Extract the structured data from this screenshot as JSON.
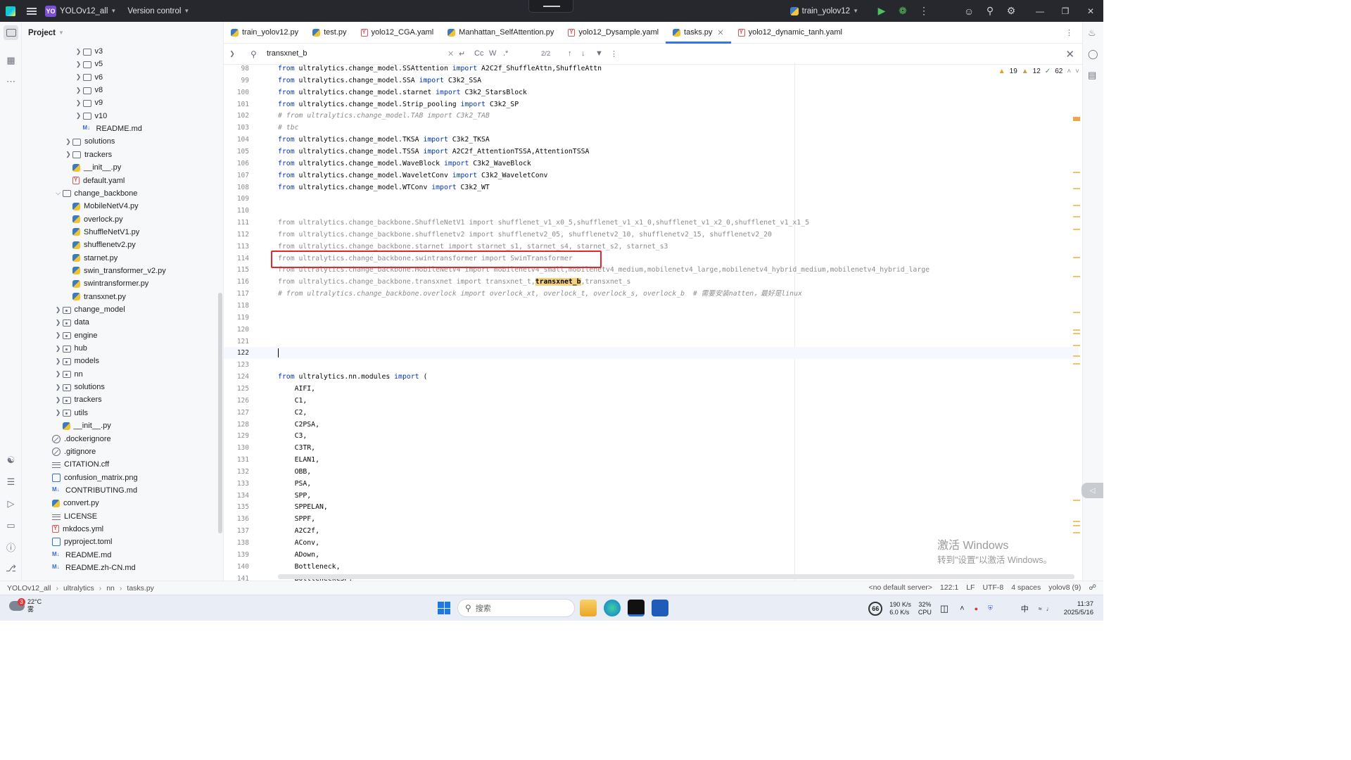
{
  "titlebar": {
    "project_badge": "YO",
    "project": "YOLOv12_all",
    "vcs": "Version control",
    "run_config": "train_yolov12"
  },
  "project_panel": {
    "title": "Project"
  },
  "tree": [
    {
      "d": 5,
      "t": "folder",
      "label": "v3",
      "c": true
    },
    {
      "d": 5,
      "t": "folder",
      "label": "v5",
      "c": true
    },
    {
      "d": 5,
      "t": "folder",
      "label": "v6",
      "c": true
    },
    {
      "d": 5,
      "t": "folder",
      "label": "v8",
      "c": true
    },
    {
      "d": 5,
      "t": "folder",
      "label": "v9",
      "c": true
    },
    {
      "d": 5,
      "t": "folder",
      "label": "v10",
      "c": true
    },
    {
      "d": 5,
      "t": "md",
      "label": "README.md"
    },
    {
      "d": 4,
      "t": "folder",
      "label": "solutions",
      "c": true
    },
    {
      "d": 4,
      "t": "folder",
      "label": "trackers",
      "c": true
    },
    {
      "d": 4,
      "t": "py",
      "label": "__init__.py"
    },
    {
      "d": 4,
      "t": "yaml",
      "label": "default.yaml"
    },
    {
      "d": 3,
      "t": "folder",
      "label": "change_backbone",
      "o": true
    },
    {
      "d": 4,
      "t": "py",
      "label": "MobileNetV4.py"
    },
    {
      "d": 4,
      "t": "py",
      "label": "overlock.py"
    },
    {
      "d": 4,
      "t": "py",
      "label": "ShuffleNetV1.py"
    },
    {
      "d": 4,
      "t": "py",
      "label": "shufflenetv2.py"
    },
    {
      "d": 4,
      "t": "py",
      "label": "starnet.py"
    },
    {
      "d": 4,
      "t": "py",
      "label": "swin_transformer_v2.py"
    },
    {
      "d": 4,
      "t": "py",
      "label": "swintransformer.py"
    },
    {
      "d": 4,
      "t": "py",
      "label": "transxnet.py"
    },
    {
      "d": 3,
      "t": "pkg",
      "label": "change_model",
      "c": true
    },
    {
      "d": 3,
      "t": "pkg",
      "label": "data",
      "c": true
    },
    {
      "d": 3,
      "t": "pkg",
      "label": "engine",
      "c": true
    },
    {
      "d": 3,
      "t": "pkg",
      "label": "hub",
      "c": true
    },
    {
      "d": 3,
      "t": "pkg",
      "label": "models",
      "c": true
    },
    {
      "d": 3,
      "t": "pkg",
      "label": "nn",
      "c": true
    },
    {
      "d": 3,
      "t": "pkg",
      "label": "solutions",
      "c": true
    },
    {
      "d": 3,
      "t": "pkg",
      "label": "trackers",
      "c": true
    },
    {
      "d": 3,
      "t": "pkg",
      "label": "utils",
      "c": true
    },
    {
      "d": 3,
      "t": "py",
      "label": "__init__.py"
    },
    {
      "d": 2,
      "t": "ignore",
      "label": ".dockerignore"
    },
    {
      "d": 2,
      "t": "ignore",
      "label": ".gitignore"
    },
    {
      "d": 2,
      "t": "txt",
      "label": "CITATION.cff"
    },
    {
      "d": 2,
      "t": "img",
      "label": "confusion_matrix.png"
    },
    {
      "d": 2,
      "t": "md",
      "label": "CONTRIBUTING.md"
    },
    {
      "d": 2,
      "t": "py",
      "label": "convert.py"
    },
    {
      "d": 2,
      "t": "txt",
      "label": "LICENSE"
    },
    {
      "d": 2,
      "t": "yaml",
      "label": "mkdocs.yml"
    },
    {
      "d": 2,
      "t": "toml",
      "label": "pyproject.toml"
    },
    {
      "d": 2,
      "t": "md",
      "label": "README.md"
    },
    {
      "d": 2,
      "t": "md",
      "label": "README.zh-CN.md"
    }
  ],
  "tabs": [
    {
      "label": "train_yolov12.py",
      "t": "py"
    },
    {
      "label": "test.py",
      "t": "py"
    },
    {
      "label": "yolo12_CGA.yaml",
      "t": "yaml"
    },
    {
      "label": "Manhattan_SelfAttention.py",
      "t": "py"
    },
    {
      "label": "yolo12_Dysample.yaml",
      "t": "yaml"
    },
    {
      "label": "tasks.py",
      "t": "py",
      "active": true
    },
    {
      "label": "yolo12_dynamic_tanh.yaml",
      "t": "yaml"
    }
  ],
  "find": {
    "query": "transxnet_b",
    "match_count": "2/2",
    "opt_case": "Cc",
    "opt_word": "W",
    "opt_regex": ".*"
  },
  "inspections": {
    "warnings": "19",
    "weak_warnings": "12",
    "typos": "62"
  },
  "code": [
    {
      "n": "98",
      "s": [
        [
          "kw",
          "from"
        ],
        [
          "",
          "ultralytics.change_model.SSAttention "
        ],
        [
          "kw",
          "import"
        ],
        [
          "",
          " A2C2f_ShuffleAttn,ShuffleAttn"
        ]
      ]
    },
    {
      "n": "99",
      "s": [
        [
          "kw",
          "from"
        ],
        [
          "",
          "ultralytics.change_model.SSA "
        ],
        [
          "kw",
          "import"
        ],
        [
          "",
          " C3k2_SSA"
        ]
      ]
    },
    {
      "n": "100",
      "s": [
        [
          "kw",
          "from"
        ],
        [
          "",
          "ultralytics.change_model.starnet "
        ],
        [
          "kw",
          "import"
        ],
        [
          "",
          " C3k2_StarsBlock"
        ]
      ]
    },
    {
      "n": "101",
      "s": [
        [
          "kw",
          "from"
        ],
        [
          "",
          "ultralytics.change_model.Strip_pooling "
        ],
        [
          "kw",
          "import"
        ],
        [
          "",
          " C3k2_SP"
        ]
      ]
    },
    {
      "n": "102",
      "s": [
        [
          "cm",
          "# from ultralytics.change_model.TAB import C3k2_TAB"
        ]
      ]
    },
    {
      "n": "103",
      "s": [
        [
          "cm",
          "# tbc"
        ]
      ]
    },
    {
      "n": "104",
      "s": [
        [
          "kw",
          "from"
        ],
        [
          "",
          "ultralytics.change_model.TKSA "
        ],
        [
          "kw",
          "import"
        ],
        [
          "",
          " C3k2_TKSA"
        ]
      ]
    },
    {
      "n": "105",
      "s": [
        [
          "kw",
          "from"
        ],
        [
          "",
          "ultralytics.change_model.TSSA "
        ],
        [
          "kw",
          "import"
        ],
        [
          "",
          " A2C2f_AttentionTSSA,AttentionTSSA"
        ]
      ]
    },
    {
      "n": "106",
      "s": [
        [
          "kw",
          "from"
        ],
        [
          "",
          "ultralytics.change_model.WaveBlock "
        ],
        [
          "kw",
          "import"
        ],
        [
          "",
          " C3k2_WaveBlock"
        ]
      ]
    },
    {
      "n": "107",
      "s": [
        [
          "kw",
          "from"
        ],
        [
          "",
          "ultralytics.change_model.WaveletConv "
        ],
        [
          "kw",
          "import"
        ],
        [
          "",
          " C3k2_WaveletConv"
        ]
      ]
    },
    {
      "n": "108",
      "s": [
        [
          "kw",
          "from"
        ],
        [
          "",
          "ultralytics.change_model.WTConv "
        ],
        [
          "kw",
          "import"
        ],
        [
          "",
          " C3k2_WT"
        ]
      ]
    },
    {
      "n": "109",
      "s": []
    },
    {
      "n": "110",
      "s": []
    },
    {
      "n": "111",
      "s": [
        [
          "gray",
          "from ultralytics.change_backbone.ShuffleNetV1 import shufflenet_v1_x0_5,shufflenet_v1_x1_0,shufflenet_v1_x2_0,shufflenet_v1_x1_5"
        ]
      ]
    },
    {
      "n": "112",
      "s": [
        [
          "gray",
          "from ultralytics.change_backbone.shufflenetv2 import shufflenetv2_05, shufflenetv2_10, shufflenetv2_15, shufflenetv2_20"
        ]
      ]
    },
    {
      "n": "113",
      "s": [
        [
          "gray",
          "from ultralytics.change_backbone.starnet import starnet_s1, starnet_s4, starnet_s2, starnet_s3"
        ]
      ]
    },
    {
      "n": "114",
      "s": [
        [
          "gray",
          "from ultralytics.change_backbone.swintransformer import SwinTransformer"
        ]
      ]
    },
    {
      "n": "115",
      "s": [
        [
          "gray",
          "from ultralytics.change_backbone.MobileNetV4 import mobilenetv4_small,mobilenetv4_medium,mobilenetv4_large,mobilenetv4_hybrid_medium,mobilenetv4_hybrid_large"
        ]
      ]
    },
    {
      "n": "116",
      "s": [
        [
          "gray",
          "from ultralytics.change_backbone.transxnet import transxnet_t,"
        ],
        [
          "hl",
          "transxnet_b"
        ],
        [
          "gray",
          ",transxnet_s"
        ]
      ]
    },
    {
      "n": "117",
      "s": [
        [
          "cm",
          "# from ultralytics.change_backbone.overlock import overlock_xt, overlock_t, overlock_s, overlock_b  # 需要安装natten，最好是linux"
        ]
      ]
    },
    {
      "n": "118",
      "s": []
    },
    {
      "n": "119",
      "s": []
    },
    {
      "n": "120",
      "s": []
    },
    {
      "n": "121",
      "s": []
    },
    {
      "n": "122",
      "s": [],
      "current": true
    },
    {
      "n": "123",
      "s": []
    },
    {
      "n": "124",
      "s": [
        [
          "kw",
          "from"
        ],
        [
          "",
          " ultralytics.nn.modules "
        ],
        [
          "kw",
          "import"
        ],
        [
          "",
          " ("
        ]
      ]
    },
    {
      "n": "125",
      "s": [
        [
          "",
          "    AIFI,"
        ]
      ]
    },
    {
      "n": "126",
      "s": [
        [
          "",
          "    C1,"
        ]
      ]
    },
    {
      "n": "127",
      "s": [
        [
          "",
          "    C2,"
        ]
      ]
    },
    {
      "n": "128",
      "s": [
        [
          "",
          "    C2PSA,"
        ]
      ]
    },
    {
      "n": "129",
      "s": [
        [
          "",
          "    C3,"
        ]
      ]
    },
    {
      "n": "130",
      "s": [
        [
          "",
          "    C3TR,"
        ]
      ]
    },
    {
      "n": "131",
      "s": [
        [
          "",
          "    ELAN1,"
        ]
      ]
    },
    {
      "n": "132",
      "s": [
        [
          "",
          "    OBB,"
        ]
      ]
    },
    {
      "n": "133",
      "s": [
        [
          "",
          "    PSA,"
        ]
      ]
    },
    {
      "n": "134",
      "s": [
        [
          "",
          "    SPP,"
        ]
      ]
    },
    {
      "n": "135",
      "s": [
        [
          "",
          "    SPPELAN,"
        ]
      ]
    },
    {
      "n": "136",
      "s": [
        [
          "",
          "    SPPF,"
        ]
      ]
    },
    {
      "n": "137",
      "s": [
        [
          "",
          "    A2C2f,"
        ]
      ]
    },
    {
      "n": "138",
      "s": [
        [
          "",
          "    AConv,"
        ]
      ]
    },
    {
      "n": "139",
      "s": [
        [
          "",
          "    ADown,"
        ]
      ]
    },
    {
      "n": "140",
      "s": [
        [
          "",
          "    Bottleneck,"
        ]
      ]
    },
    {
      "n": "141",
      "s": [
        [
          "",
          "    BottleneckCSP,"
        ]
      ]
    }
  ],
  "watermark": {
    "line1": "激活 Windows",
    "line2": "转到\"设置\"以激活 Windows。"
  },
  "statusbar": {
    "crumbs": [
      "YOLOv12_all",
      "ultralytics",
      "nn",
      "tasks.py"
    ],
    "server": "<no default server>",
    "position": "122:1",
    "line_sep": "LF",
    "encoding": "UTF-8",
    "indent": "4 spaces",
    "interpreter": "yolov8 (9)"
  },
  "taskbar": {
    "temperature": "22°C",
    "weather": "雾",
    "notif_count": "3",
    "search_placeholder": "搜索",
    "cpu_gauge": "66",
    "net_up": "190 K/s",
    "net_down": "6.0 K/s",
    "cpu_pct": "32%",
    "cpu_label": "CPU",
    "ime": "中",
    "time": "11:37",
    "date": "2025/5/16"
  },
  "colors": {
    "keyword": "#0033b3",
    "comment": "#8c8c8c",
    "highlight": "#f5d27a",
    "annotation_box": "#e3272c",
    "tab_underline": "#3574f0"
  }
}
